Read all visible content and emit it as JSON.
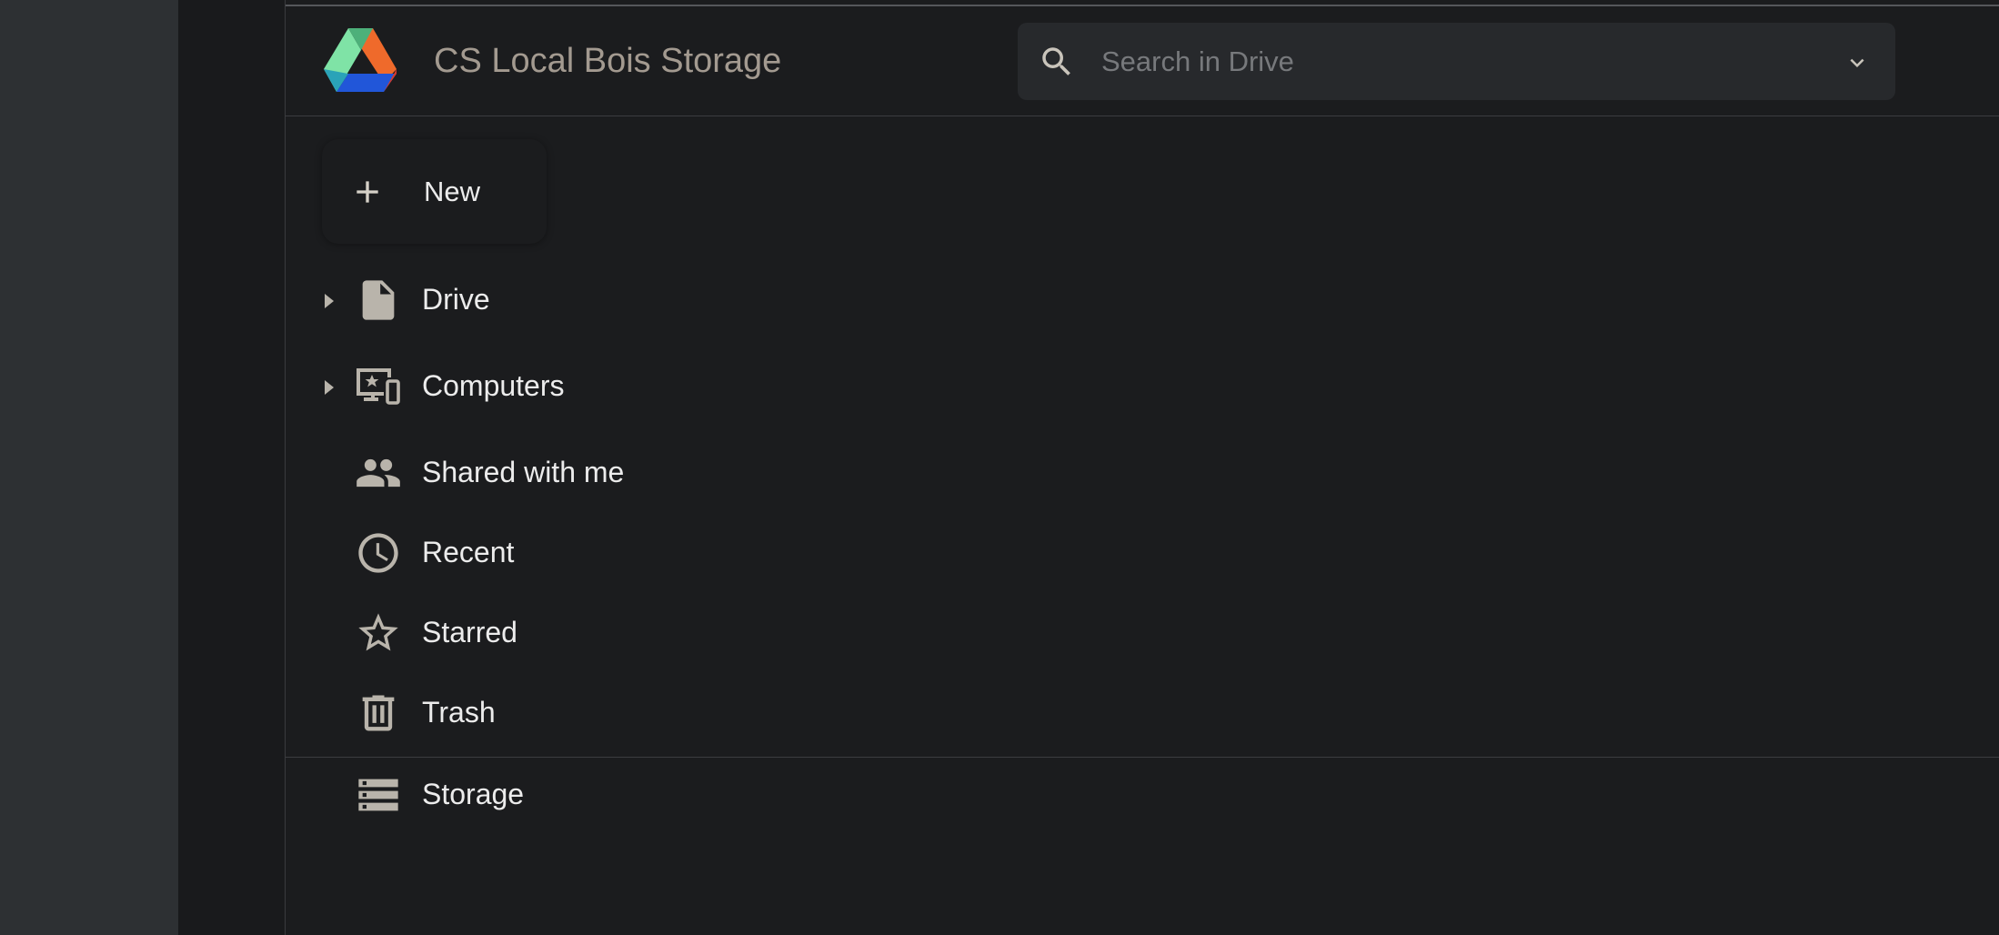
{
  "app": {
    "title": "CS Local Bois Storage",
    "logo_icon": "drive-logo-icon",
    "brand_colors": {
      "green": "#7fe3a6",
      "orange": "#ef6a2b",
      "blue": "#2156d9"
    }
  },
  "search": {
    "placeholder": "Search in Drive",
    "value": "",
    "icon": "search-icon",
    "options_icon": "chevron-down-icon"
  },
  "new_button": {
    "label": "New",
    "icon": "plus-icon"
  },
  "nav": {
    "items": [
      {
        "label": "Drive",
        "icon": "file-icon",
        "expandable": true
      },
      {
        "label": "Computers",
        "icon": "computers-icon",
        "expandable": true
      },
      {
        "label": "Shared with me",
        "icon": "people-icon",
        "expandable": false
      },
      {
        "label": "Recent",
        "icon": "clock-icon",
        "expandable": false
      },
      {
        "label": "Starred",
        "icon": "star-icon",
        "expandable": false
      },
      {
        "label": "Trash",
        "icon": "trash-icon",
        "expandable": false
      },
      {
        "label": "Storage",
        "icon": "storage-icon",
        "expandable": false
      }
    ]
  },
  "colors": {
    "background": "#1b1c1e",
    "text": "#ececec",
    "icon": "#b9b4ab",
    "title": "#a39a90"
  }
}
